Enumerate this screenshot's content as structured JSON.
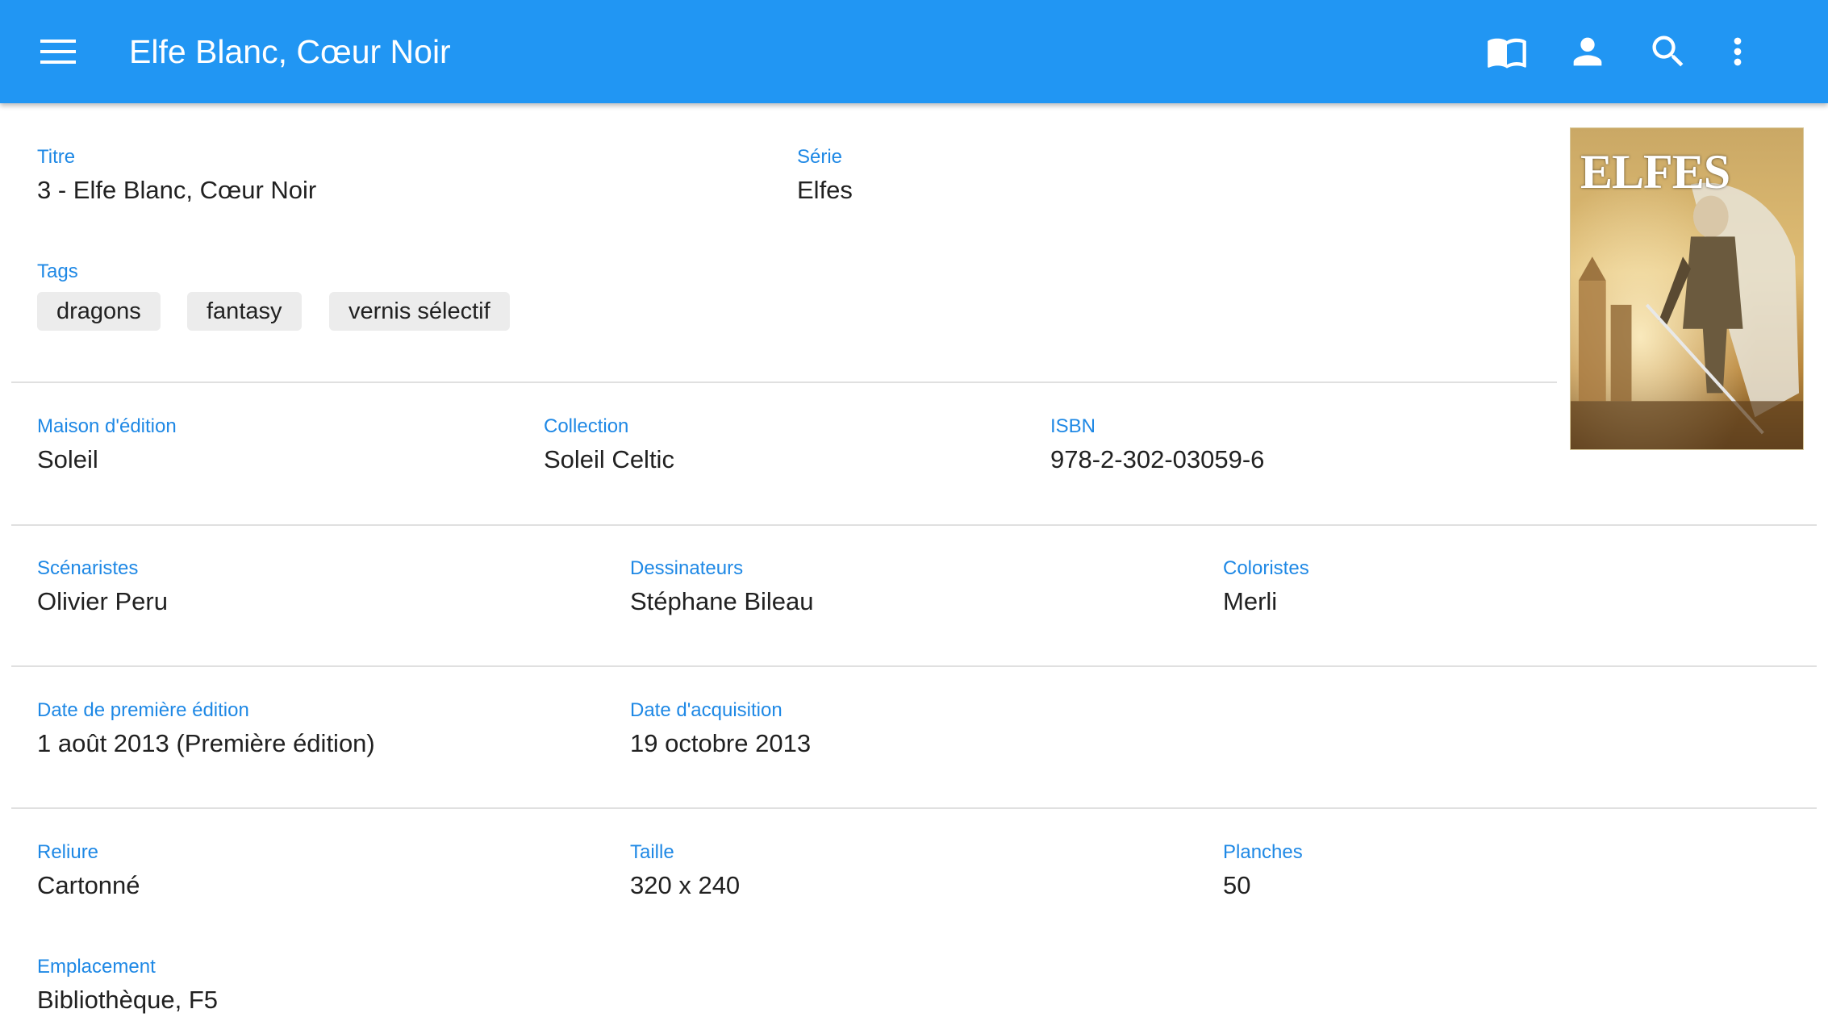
{
  "appbar": {
    "title": "Elfe Blanc, Cœur Noir",
    "menu_icon": "menu-icon",
    "actions": [
      "book-open-icon",
      "person-icon",
      "search-icon",
      "more-vert-icon"
    ]
  },
  "colors": {
    "primary": "#2196f3",
    "label": "#1e88e5",
    "chip_bg": "#ececec",
    "divider": "#e0e0e0"
  },
  "details": {
    "titre": {
      "label": "Titre",
      "value": "3 - Elfe Blanc, Cœur Noir"
    },
    "serie": {
      "label": "Série",
      "value": "Elfes"
    },
    "tags": {
      "label": "Tags",
      "items": [
        "dragons",
        "fantasy",
        "vernis sélectif"
      ]
    },
    "maison": {
      "label": "Maison d'édition",
      "value": "Soleil"
    },
    "collection": {
      "label": "Collection",
      "value": "Soleil Celtic"
    },
    "isbn": {
      "label": "ISBN",
      "value": "978-2-302-03059-6"
    },
    "scenaristes": {
      "label": "Scénaristes",
      "value": "Olivier Peru"
    },
    "dessinateurs": {
      "label": "Dessinateurs",
      "value": "Stéphane Bileau"
    },
    "coloristes": {
      "label": "Coloristes",
      "value": "Merli"
    },
    "date_premiere": {
      "label": "Date de première édition",
      "value": "1 août 2013 (Première édition)"
    },
    "date_acquisition": {
      "label": "Date d'acquisition",
      "value": "19 octobre 2013"
    },
    "reliure": {
      "label": "Reliure",
      "value": "Cartonné"
    },
    "taille": {
      "label": "Taille",
      "value": "320 x 240"
    },
    "planches": {
      "label": "Planches",
      "value": "50"
    },
    "emplacement": {
      "label": "Emplacement",
      "value": "Bibliothèque, F5"
    }
  },
  "cover": {
    "logo_text": "ELFES"
  }
}
